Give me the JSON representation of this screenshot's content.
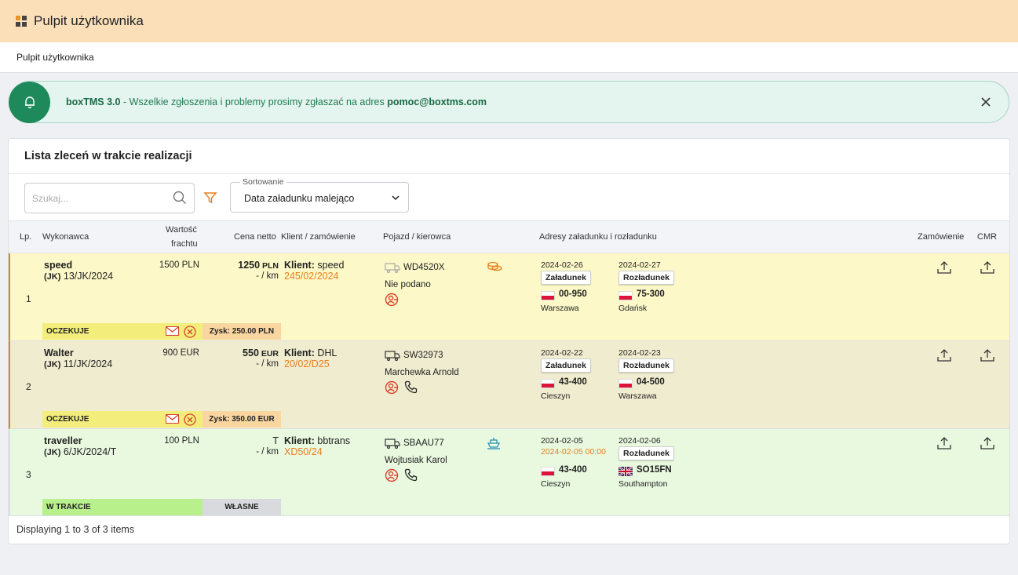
{
  "header": {
    "title": "Pulpit użytkownika"
  },
  "breadcrumb": {
    "label": "Pulpit użytkownika"
  },
  "alert": {
    "app": "boxTMS 3.0",
    "text": " - Wszelkie zgłoszenia i problemy prosimy zgłaszać na adres ",
    "email": "pomoc@boxtms.com"
  },
  "card": {
    "title": "Lista zleceń w trakcie realizacji",
    "search_placeholder": "Szukaj...",
    "sort_label": "Sortowanie",
    "sort_value": "Data załadunku malejąco"
  },
  "columns": {
    "lp": "Lp.",
    "contractor": "Wykonawca",
    "freight_line1": "Wartość",
    "freight_line2": "frachtu",
    "net": "Cena netto",
    "client": "Klient / zamówienie",
    "vehicle": "Pojazd / kierowca",
    "addresses": "Adresy załadunku i rozładunku",
    "order": "Zamówienie",
    "cmr": "CMR"
  },
  "rows": [
    {
      "lp": "1",
      "name": "speed",
      "prefix": "(JK)",
      "number": " 13/JK/2024",
      "freight": "1500 PLN",
      "net_value": "1250",
      "net_currency": " PLN",
      "per_km": "- / km",
      "client_label": "Klient:",
      "client": " speed",
      "order_no": "245/02/2024",
      "plate": "WD4520X",
      "driver": "Nie podano",
      "load_date": "2024-02-26",
      "load_badge": "Załadunek",
      "load_zip": "00-950",
      "load_city": "Warszawa",
      "unload_date": "2024-02-27",
      "unload_badge": "Rozładunek",
      "unload_zip": "75-300",
      "unload_city": "Gdańsk",
      "status": "OCZEKUJE",
      "profit": "Zysk: 250.00 PLN"
    },
    {
      "lp": "2",
      "name": "Walter",
      "prefix": "(JK)",
      "number": " 11/JK/2024",
      "freight": "900 EUR",
      "net_value": "550",
      "net_currency": " EUR",
      "per_km": "- / km",
      "client_label": "Klient:",
      "client": " DHL",
      "order_no": "20/02/D25",
      "plate": "SW32973",
      "driver": "Marchewka Arnold",
      "load_date": "2024-02-22",
      "load_badge": "Załadunek",
      "load_zip": "43-400",
      "load_city": "Cieszyn",
      "unload_date": "2024-02-23",
      "unload_badge": "Rozładunek",
      "unload_zip": "04-500",
      "unload_city": "Warszawa",
      "status": "OCZEKUJE",
      "profit": "Zysk: 350.00 EUR"
    },
    {
      "lp": "3",
      "name": "traveller",
      "prefix": "(JK)",
      "number": " 6/JK/2024/T",
      "freight": "100 PLN",
      "net_value": "T",
      "per_km": "- / km",
      "client_label": "Klient:",
      "client": " bbtrans",
      "order_no": "XD50/24",
      "plate": "SBAAU77",
      "driver": "Wojtusiak Karol",
      "load_date": "2024-02-05",
      "load_warn": "2024-02-05 00:00",
      "load_zip": "43-400",
      "load_city": "Cieszyn",
      "unload_date": "2024-02-06",
      "unload_badge": "Rozładunek",
      "unload_zip": "SO15FN",
      "unload_city": "Southampton",
      "status": "W TRAKCIE",
      "profit": "WŁASNE"
    }
  ],
  "footer": {
    "text": "Displaying 1 to 3 of 3 items"
  },
  "colors": {
    "accent": "#e67e22",
    "alert_green": "#1e8a5b",
    "status_wait": "#f3ee7c",
    "status_progress": "#b8f08c"
  }
}
